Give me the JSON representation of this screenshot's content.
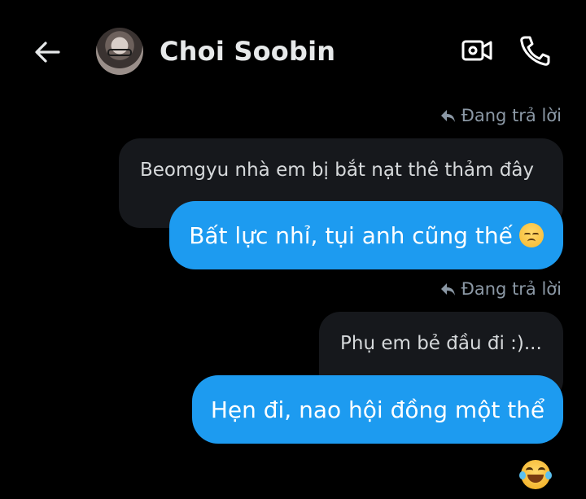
{
  "header": {
    "contact_name": "Choi Soobin",
    "back_icon": "arrow-left-icon",
    "video_icon": "video-call-icon",
    "phone_icon": "phone-call-icon"
  },
  "messages": [
    {
      "reply_label": "Đang trả lời",
      "quoted_text": "Beomgyu nhà em bị bắt nạt thê thảm đây",
      "text": "Bất lực nhỉ, tụi anh cũng thế",
      "emoji": "disappointed-face-icon"
    },
    {
      "reply_label": "Đang trả lời",
      "quoted_text": "Phụ em bẻ đầu đi :)...",
      "text": "Hẹn đi, nao hội đồng một thể",
      "reaction": "tears-of-joy-icon"
    }
  ],
  "colors": {
    "background": "#000000",
    "bubble_blue": "#1d9bf0",
    "quoted_bg": "#16181c",
    "muted_text": "#8b98a5"
  }
}
